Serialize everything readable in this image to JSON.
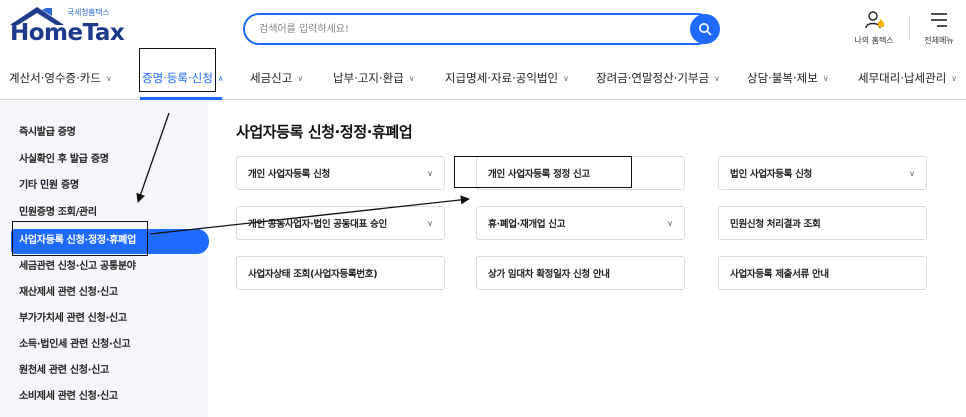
{
  "header": {
    "logo_sub": "국세청홈택스",
    "logo_main": "HomeTax",
    "search_placeholder": "검색어를 입력하세요!",
    "my_home_label": "나의 홈택스",
    "all_menu_label": "전체메뉴"
  },
  "gnb": {
    "items": [
      {
        "label": "계산서·영수증·카드"
      },
      {
        "label": "증명·등록·신청"
      },
      {
        "label": "세금신고"
      },
      {
        "label": "납부·고지·환급"
      },
      {
        "label": "지급명세·자료·공익법인"
      },
      {
        "label": "장려금·연말정산·기부금"
      },
      {
        "label": "상담·불복·제보"
      },
      {
        "label": "세무대리·납세관리"
      }
    ],
    "active_index": 1
  },
  "sidebar": {
    "items": [
      {
        "label": "즉시발급 증명"
      },
      {
        "label": "사실확인 후 발급 증명"
      },
      {
        "label": "기타 민원 증명"
      },
      {
        "label": "민원증명 조회/관리"
      },
      {
        "label": "사업자등록 신청·정정·휴폐업"
      },
      {
        "label": "세금관련 신청·신고 공통분야"
      },
      {
        "label": "재산제세 관련 신청·신고"
      },
      {
        "label": "부가가치세 관련 신청·신고"
      },
      {
        "label": "소득·법인세 관련 신청·신고"
      },
      {
        "label": "원천세 관련 신청·신고"
      },
      {
        "label": "소비제세 관련 신청·신고"
      }
    ],
    "active_index": 4
  },
  "content": {
    "title": "사업자등록 신청·정정·휴폐업",
    "cards": [
      {
        "label": "개인 사업자등록 신청"
      },
      {
        "label": "개인 사업자등록 정정 신고"
      },
      {
        "label": "법인 사업자등록 신청"
      },
      {
        "label": "개인 공동사업자·법인 공동대표 승인"
      },
      {
        "label": "휴·폐업·재개업 신고"
      },
      {
        "label": "민원신청 처리결과 조회"
      },
      {
        "label": "사업자상태 조회(사업자등록번호)"
      },
      {
        "label": "상가 임대차 확정일자 신청 안내"
      },
      {
        "label": "사업자등록 제출서류 안내"
      }
    ]
  },
  "colors": {
    "accent": "#1f6bff",
    "brand_dark": "#1c3b8a",
    "sidebar_bg": "#f4f6fa",
    "annotation": "#111111"
  }
}
